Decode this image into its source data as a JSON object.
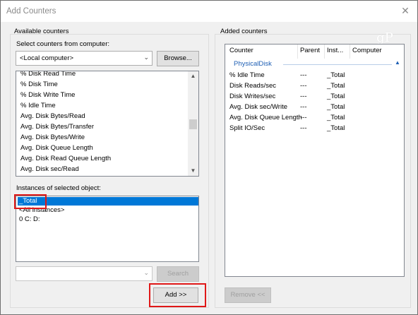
{
  "window": {
    "title": "Add Counters",
    "close_glyph": "✕"
  },
  "available": {
    "group_label": "Available counters",
    "computer_label": "Select counters from computer:",
    "computer_value": "<Local computer>",
    "browse_label": "Browse...",
    "counters": [
      "% Disk Read Time",
      "% Disk Time",
      "% Disk Write Time",
      "% Idle Time",
      "Avg. Disk Bytes/Read",
      "Avg. Disk Bytes/Transfer",
      "Avg. Disk Bytes/Write",
      "Avg. Disk Queue Length",
      "Avg. Disk Read Queue Length",
      "Avg. Disk sec/Read"
    ]
  },
  "instances": {
    "label": "Instances of selected object:",
    "items": [
      "_Total",
      "<All instances>",
      "0 C: D:"
    ],
    "selected_index": 0
  },
  "search": {
    "value": "",
    "button_label": "Search"
  },
  "add_button_label": "Add >>",
  "added": {
    "group_label": "Added counters",
    "columns": [
      "Counter",
      "Parent",
      "Inst...",
      "Computer"
    ],
    "group_name": "PhysicalDisk",
    "rows": [
      {
        "counter": "% Idle Time",
        "parent": "---",
        "instance": "_Total"
      },
      {
        "counter": "Disk Reads/sec",
        "parent": "---",
        "instance": "_Total"
      },
      {
        "counter": "Disk Writes/sec",
        "parent": "---",
        "instance": "_Total"
      },
      {
        "counter": "Avg. Disk sec/Write",
        "parent": "---",
        "instance": "_Total"
      },
      {
        "counter": "Avg. Disk Queue Length",
        "parent": "---",
        "instance": "_Total"
      },
      {
        "counter": "Split IO/Sec",
        "parent": "---",
        "instance": "_Total"
      }
    ],
    "remove_label": "Remove <<"
  },
  "watermark_text": "gP",
  "colors": {
    "selection": "#0078d7",
    "highlight_box": "#e01818",
    "group_text": "#1e5fb4"
  }
}
